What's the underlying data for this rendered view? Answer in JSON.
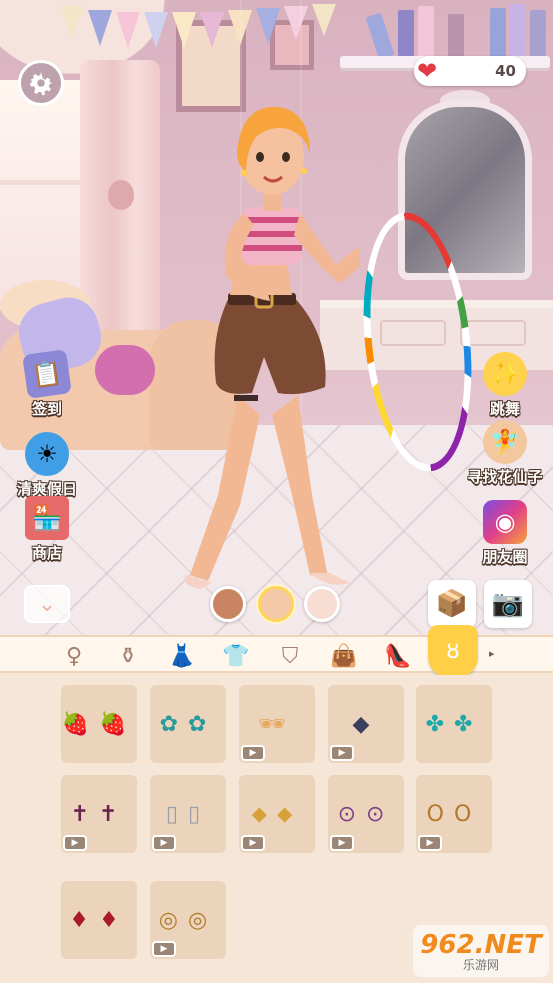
{
  "hud": {
    "hearts": "40"
  },
  "side_left": [
    {
      "label": "签到",
      "icon": "calendar-icon"
    },
    {
      "label": "清爽假日",
      "icon": "holiday-icon"
    },
    {
      "label": "商店",
      "icon": "shop-icon"
    }
  ],
  "side_right": [
    {
      "label": "跳舞",
      "icon": "dance-stage-icon"
    },
    {
      "label": "寻找花仙子",
      "icon": "fairy-icon"
    },
    {
      "label": "朋友圈",
      "icon": "camera-app-icon"
    }
  ],
  "skin_tones": [
    {
      "color": "#c98563",
      "selected": false
    },
    {
      "color": "#f4c9a8",
      "selected": true
    },
    {
      "color": "#f7ddd2",
      "selected": false
    }
  ],
  "categories": [
    {
      "name": "hair",
      "icon": "hair-icon",
      "active": false
    },
    {
      "name": "makeup",
      "icon": "makeup-icon",
      "active": false
    },
    {
      "name": "dress",
      "icon": "dress-icon",
      "active": false
    },
    {
      "name": "top",
      "icon": "shirt-icon",
      "active": false
    },
    {
      "name": "skirt",
      "icon": "skirt-icon",
      "active": false
    },
    {
      "name": "bag",
      "icon": "bag-icon",
      "active": false
    },
    {
      "name": "shoes",
      "icon": "shoe-icon",
      "active": false
    },
    {
      "name": "accessories",
      "icon": "earring-icon",
      "active": true
    }
  ],
  "items": [
    {
      "art": "strawberry-earrings",
      "glyph": "🍓🍓",
      "video": false
    },
    {
      "art": "flower-studs",
      "glyph": "✿✿",
      "video": false
    },
    {
      "art": "sunglasses",
      "glyph": "🕶",
      "video": true
    },
    {
      "art": "crystal-drop",
      "glyph": "◆",
      "video": true
    },
    {
      "art": "clover-studs",
      "glyph": "✤✤",
      "video": false
    },
    {
      "art": "cross-earrings",
      "glyph": "✝✝",
      "video": true
    },
    {
      "art": "silver-hoops",
      "glyph": "▯▯",
      "video": true
    },
    {
      "art": "gem-drops",
      "glyph": "⬥⬥",
      "video": true
    },
    {
      "art": "charm-earrings",
      "glyph": "⊙⊙",
      "video": true
    },
    {
      "art": "gold-hoops",
      "glyph": "OO",
      "video": true
    },
    {
      "art": "red-drops",
      "glyph": "♦♦",
      "video": false
    },
    {
      "art": "swirl-glasses",
      "glyph": "◎◎",
      "video": true
    }
  ],
  "watermark": {
    "line1": "962.NET",
    "line2": "乐游网"
  },
  "colors": {
    "accent": "#ffcf45",
    "panel": "#f6e6d7",
    "card": "#ecd3bb"
  }
}
